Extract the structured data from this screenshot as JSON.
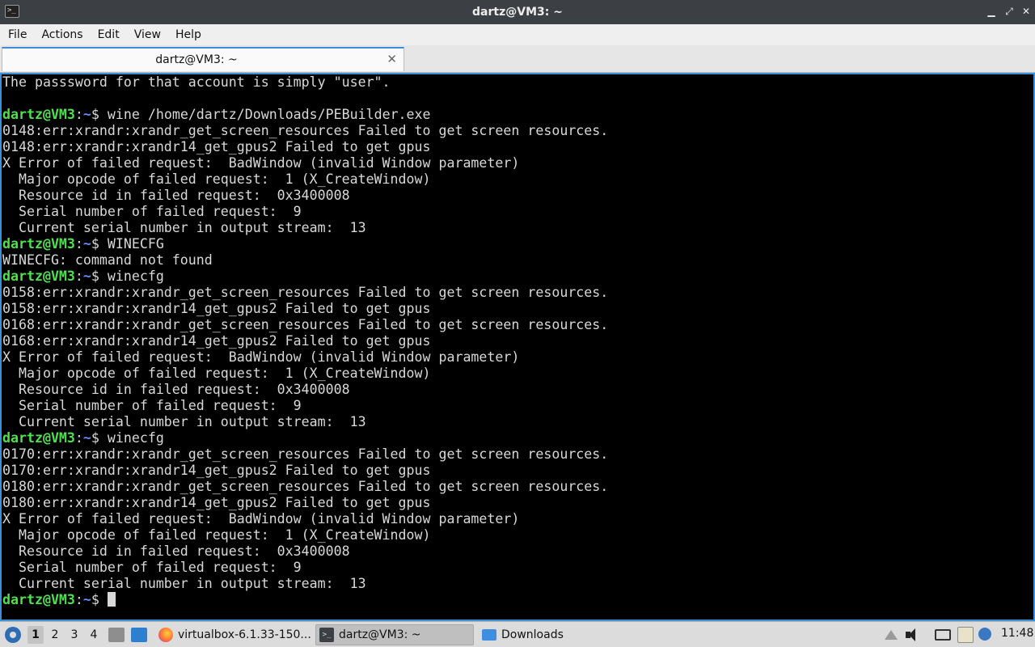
{
  "window": {
    "title": "dartz@VM3: ~",
    "icon": "terminal-icon",
    "controls": {
      "minimize": "▁",
      "maximize": "⤢",
      "close": "✕"
    }
  },
  "menubar": {
    "items": [
      "File",
      "Actions",
      "Edit",
      "View",
      "Help"
    ]
  },
  "tabs": [
    {
      "label": "dartz@VM3: ~",
      "close": "✕"
    }
  ],
  "terminal": {
    "prompt": {
      "user": "dartz@VM3",
      "colon": ":",
      "path": "~",
      "symbol": "$ "
    },
    "lines": [
      {
        "type": "text",
        "text": "The passsword for that account is simply \"user\"."
      },
      {
        "type": "text",
        "text": ""
      },
      {
        "type": "prompt",
        "cmd": "wine /home/dartz/Downloads/PEBuilder.exe"
      },
      {
        "type": "text",
        "text": "0148:err:xrandr:xrandr_get_screen_resources Failed to get screen resources."
      },
      {
        "type": "text",
        "text": "0148:err:xrandr:xrandr14_get_gpus2 Failed to get gpus"
      },
      {
        "type": "text",
        "text": "X Error of failed request:  BadWindow (invalid Window parameter)"
      },
      {
        "type": "text",
        "text": "  Major opcode of failed request:  1 (X_CreateWindow)"
      },
      {
        "type": "text",
        "text": "  Resource id in failed request:  0x3400008"
      },
      {
        "type": "text",
        "text": "  Serial number of failed request:  9"
      },
      {
        "type": "text",
        "text": "  Current serial number in output stream:  13"
      },
      {
        "type": "prompt",
        "cmd": "WINECFG"
      },
      {
        "type": "text",
        "text": "WINECFG: command not found"
      },
      {
        "type": "prompt",
        "cmd": "winecfg"
      },
      {
        "type": "text",
        "text": "0158:err:xrandr:xrandr_get_screen_resources Failed to get screen resources."
      },
      {
        "type": "text",
        "text": "0158:err:xrandr:xrandr14_get_gpus2 Failed to get gpus"
      },
      {
        "type": "text",
        "text": "0168:err:xrandr:xrandr_get_screen_resources Failed to get screen resources."
      },
      {
        "type": "text",
        "text": "0168:err:xrandr:xrandr14_get_gpus2 Failed to get gpus"
      },
      {
        "type": "text",
        "text": "X Error of failed request:  BadWindow (invalid Window parameter)"
      },
      {
        "type": "text",
        "text": "  Major opcode of failed request:  1 (X_CreateWindow)"
      },
      {
        "type": "text",
        "text": "  Resource id in failed request:  0x3400008"
      },
      {
        "type": "text",
        "text": "  Serial number of failed request:  9"
      },
      {
        "type": "text",
        "text": "  Current serial number in output stream:  13"
      },
      {
        "type": "prompt",
        "cmd": "winecfg"
      },
      {
        "type": "text",
        "text": "0170:err:xrandr:xrandr_get_screen_resources Failed to get screen resources."
      },
      {
        "type": "text",
        "text": "0170:err:xrandr:xrandr14_get_gpus2 Failed to get gpus"
      },
      {
        "type": "text",
        "text": "0180:err:xrandr:xrandr_get_screen_resources Failed to get screen resources."
      },
      {
        "type": "text",
        "text": "0180:err:xrandr:xrandr14_get_gpus2 Failed to get gpus"
      },
      {
        "type": "text",
        "text": "X Error of failed request:  BadWindow (invalid Window parameter)"
      },
      {
        "type": "text",
        "text": "  Major opcode of failed request:  1 (X_CreateWindow)"
      },
      {
        "type": "text",
        "text": "  Resource id in failed request:  0x3400008"
      },
      {
        "type": "text",
        "text": "  Serial number of failed request:  9"
      },
      {
        "type": "text",
        "text": "  Current serial number in output stream:  13"
      },
      {
        "type": "prompt",
        "cmd": "",
        "cursor": true
      }
    ]
  },
  "taskbar": {
    "workspaces": [
      "1",
      "2",
      "3",
      "4"
    ],
    "active_workspace": "1",
    "tasks": [
      {
        "label": "virtualbox-6.1.33-150...",
        "icon": "firefox-icon"
      },
      {
        "label": "dartz@VM3: ~",
        "icon": "terminal-icon"
      },
      {
        "label": "Downloads",
        "icon": "folder-icon"
      }
    ],
    "clock": "11:48"
  },
  "colors": {
    "prompt_user": "#4ee14e",
    "prompt_path": "#5c8cff",
    "terminal_bg": "#000000",
    "terminal_fg": "#d8d8d8",
    "focus_border": "#3a8fd9"
  }
}
